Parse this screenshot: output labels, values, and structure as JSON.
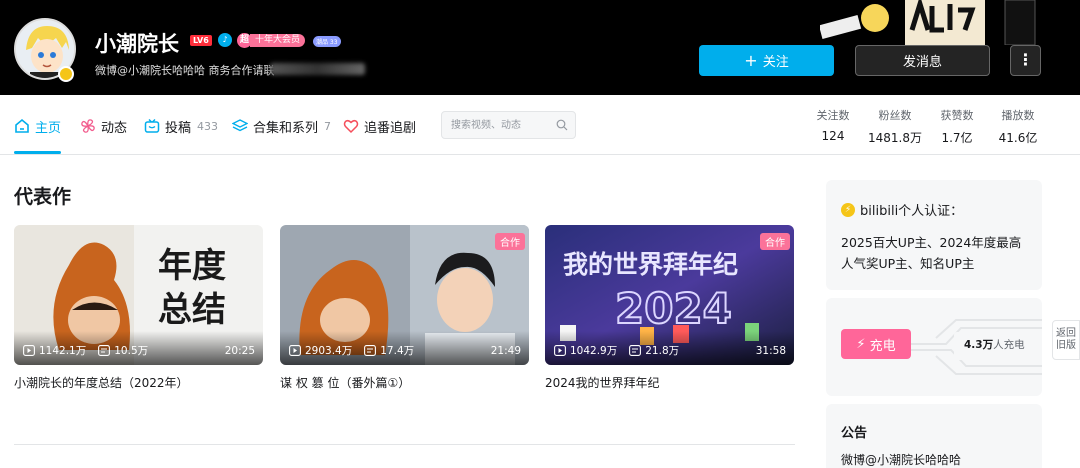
{
  "header": {
    "username": "小潮院长",
    "level": "LV6",
    "award_text": "十年大会员",
    "award_prefix": "超",
    "small_badge": "潮品 33",
    "bio": "微博@小潮院长哈哈哈 商务合作请联",
    "follow_label": "关注",
    "message_label": "发消息",
    "more_label": "⋮",
    "banner_art_text": "小潮"
  },
  "nav": {
    "items": [
      {
        "label": "主页",
        "icon": "home-icon",
        "count": ""
      },
      {
        "label": "动态",
        "icon": "dynamic-icon",
        "count": ""
      },
      {
        "label": "投稿",
        "icon": "tv-icon",
        "count": "433"
      },
      {
        "label": "合集和系列",
        "icon": "layers-icon",
        "count": "7"
      },
      {
        "label": "追番追剧",
        "icon": "heart-icon",
        "count": ""
      }
    ],
    "search_placeholder": "搜索视频、动态",
    "stats": [
      {
        "label": "关注数",
        "value": "124"
      },
      {
        "label": "粉丝数",
        "value": "1481.8万"
      },
      {
        "label": "获赞数",
        "value": "1.7亿"
      },
      {
        "label": "播放数",
        "value": "41.6亿"
      }
    ]
  },
  "main": {
    "section_title": "代表作",
    "videos": [
      {
        "title": "小潮院长的年度总结（2022年）",
        "plays": "1142.1万",
        "danmaku": "10.5万",
        "duration": "20:25",
        "tag": "",
        "thumb_text": [
          "年度",
          "总结"
        ]
      },
      {
        "title": "谋 权 篡 位（番外篇①）",
        "plays": "2903.4万",
        "danmaku": "17.4万",
        "duration": "21:49",
        "tag": "合作",
        "thumb_text": []
      },
      {
        "title": "2024我的世界拜年纪",
        "plays": "1042.9万",
        "danmaku": "21.8万",
        "duration": "31:58",
        "tag": "合作",
        "thumb_text": [
          "我的世界拜年纪",
          "2024"
        ]
      }
    ]
  },
  "sidebar": {
    "cert_title": "bilibili个人认证：",
    "cert_text": "2025百大UP主、2024年度最高人气奖UP主、知名UP主",
    "charge_label": "充电",
    "charge_count_num": "4.3万",
    "charge_count_suffix": "人充电",
    "notice_title": "公告",
    "notice_text": "微博@小潮院长哈哈哈",
    "back_label_1": "返回",
    "back_label_2": "旧版"
  },
  "colors": {
    "accent": "#00aeec",
    "pink": "#fb7299",
    "banner": "#000000"
  }
}
